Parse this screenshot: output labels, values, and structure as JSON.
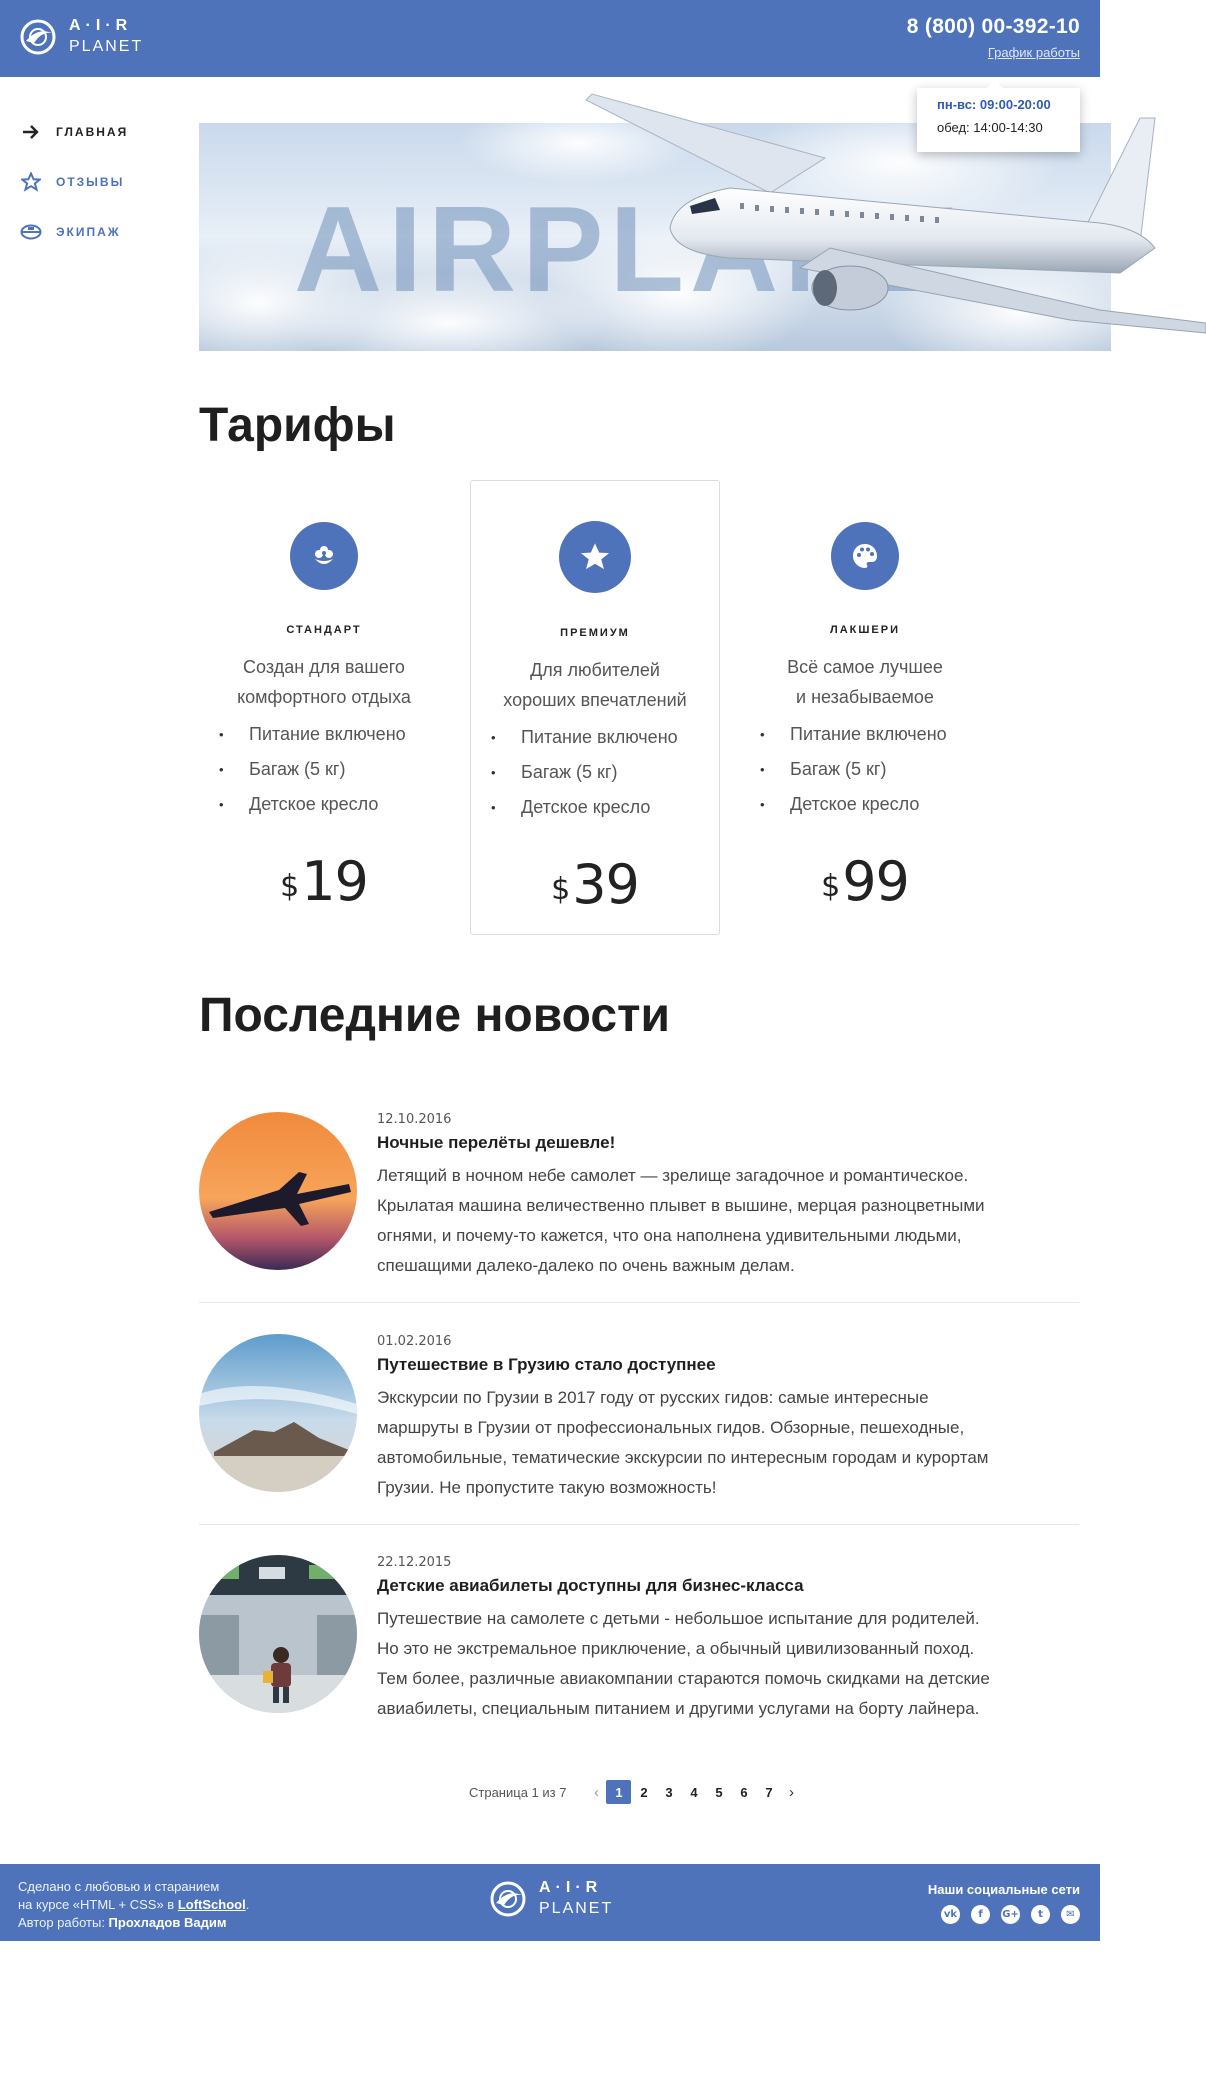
{
  "header": {
    "logo_line1": "A·I·R",
    "logo_line2": "PLANET",
    "phone": "8 (800) 00-392-10",
    "schedule_link": "График работы"
  },
  "tooltip": {
    "hours": "пн-вс: 09:00-20:00",
    "lunch": "обед: 14:00-14:30"
  },
  "nav": [
    {
      "label": "ГЛАВНАЯ",
      "icon": "arrow-right-icon",
      "active": true
    },
    {
      "label": "ОТЗЫВЫ",
      "icon": "star-outline-icon",
      "active": false
    },
    {
      "label": "ЭКИПАЖ",
      "icon": "crew-hat-icon",
      "active": false
    }
  ],
  "hero": {
    "word": "AIRPLANE"
  },
  "tariffs": {
    "title": "Тарифы",
    "items": [
      {
        "name": "СТАНДАРТ",
        "desc_line1": "Создан для вашего",
        "desc_line2": "комфортного отдыха",
        "features": [
          "Питание включено",
          "Багаж (5 кг)",
          "Детское кресло"
        ],
        "currency": "$",
        "price": "19",
        "icon": "flower-icon"
      },
      {
        "name": "ПРЕМИУМ",
        "desc_line1": "Для любителей",
        "desc_line2": "хороших впечатлений",
        "features": [
          "Питание включено",
          "Багаж (5 кг)",
          "Детское кресло"
        ],
        "currency": "$",
        "price": "39",
        "icon": "star-icon"
      },
      {
        "name": "ЛАКШЕРИ",
        "desc_line1": "Всё самое лучшее",
        "desc_line2": "и незабываемое",
        "features": [
          "Питание включено",
          "Багаж (5 кг)",
          "Детское кресло"
        ],
        "currency": "$",
        "price": "99",
        "icon": "palette-icon"
      }
    ]
  },
  "news": {
    "title": "Последние новости",
    "items": [
      {
        "date": "12.10.2016",
        "title": "Ночные перелёты дешевле!",
        "lines": [
          "Летящий в ночном небе самолет — зрелище загадочное и романтическое.",
          "Крылатая машина величественно плывет в вышине, мерцая разноцветными",
          "огнями, и почему-то кажется, что она наполнена удивительными людьми,",
          "спешащими далеко-далеко по очень важным делам."
        ]
      },
      {
        "date": "01.02.2016",
        "title": "Путешествие в Грузию стало доступнее",
        "lines": [
          "Экскурсии по Грузии в 2017 году от русских гидов: самые интересные",
          "маршруты в Грузии от профессиональных гидов. Обзорные, пешеходные,",
          "автомобильные, тематические экскурсии по интересным городам и курортам",
          "Грузии. Не пропустите такую возможность!"
        ]
      },
      {
        "date": "22.12.2015",
        "title": "Детские авиабилеты доступны для бизнес-класса",
        "lines": [
          "Путешествие на самолете с детьми - небольшое испытание для родителей.",
          "Но это не экстремальное приключение, а обычный цивилизованный поход.",
          "Тем более, различные авиакомпании стараются помочь скидками на детские",
          "авиабилеты, специальным питанием и другими услугами на борту лайнера."
        ]
      }
    ]
  },
  "pagination": {
    "label": "Страница 1 из 7",
    "prev": "‹",
    "next": "›",
    "pages": [
      "1",
      "2",
      "3",
      "4",
      "5",
      "6",
      "7"
    ],
    "current": "1"
  },
  "footer": {
    "line1": "Сделано с любовью и старанием",
    "line2_prefix": "на курсе «HTML + CSS» в ",
    "line2_link": "LoftSchool",
    "line2_suffix": ".",
    "line3_prefix": "Автор работы: ",
    "author": "Прохладов Вадим",
    "logo_line1": "A·I·R",
    "logo_line2": "PLANET",
    "social_title": "Наши социальные сети",
    "socials": [
      {
        "icon": "vk-icon",
        "glyph": "vk"
      },
      {
        "icon": "facebook-icon",
        "glyph": "f"
      },
      {
        "icon": "google-plus-icon",
        "glyph": "G+"
      },
      {
        "icon": "twitter-icon",
        "glyph": "t"
      },
      {
        "icon": "mail-icon",
        "glyph": "✉"
      }
    ]
  },
  "colors": {
    "brand": "#4e73ba",
    "text": "#222222",
    "muted": "#555555"
  }
}
